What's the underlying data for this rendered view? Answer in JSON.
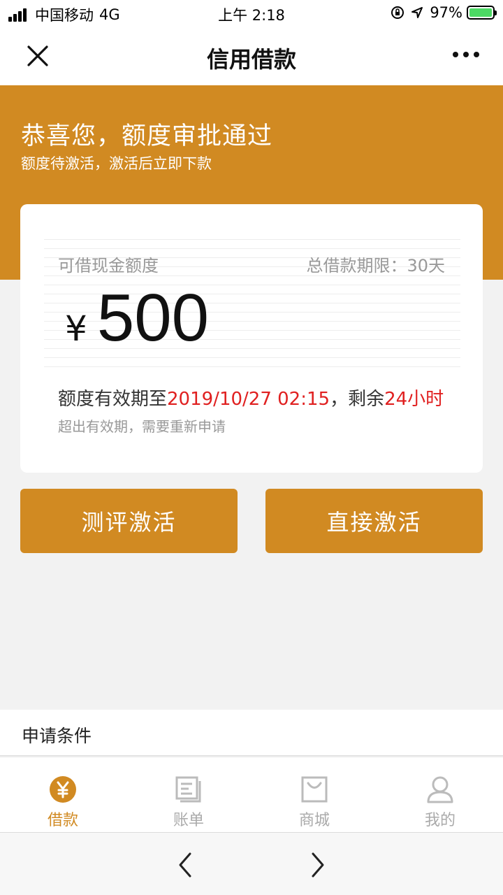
{
  "status_bar": {
    "carrier": "中国移动",
    "network": "4G",
    "time": "上午 2:18",
    "battery": "97%"
  },
  "nav": {
    "title": "信用借款"
  },
  "hero": {
    "title": "恭喜您，额度审批通过",
    "subtitle": "额度待激活，激活后立即下款"
  },
  "card": {
    "label_left": "可借现金额度",
    "label_right": "总借款期限：30天",
    "currency": "¥",
    "amount": "500",
    "validity_prefix": "额度有效期至",
    "validity_date": "2019/10/27 02:15",
    "validity_mid": "，剩余",
    "validity_remaining": "24小时",
    "note": "超出有效期，需要重新申请"
  },
  "buttons": {
    "eval_activate": "测评激活",
    "direct_activate": "直接激活"
  },
  "conditions": {
    "title": "申请条件"
  },
  "tabbar": {
    "items": [
      {
        "label": "借款",
        "icon": "yuan-icon",
        "active": true
      },
      {
        "label": "账单",
        "icon": "bill-icon",
        "active": false
      },
      {
        "label": "商城",
        "icon": "shop-icon",
        "active": false
      },
      {
        "label": "我的",
        "icon": "user-icon",
        "active": false
      }
    ]
  },
  "colors": {
    "accent": "#d18a22",
    "highlight_red": "#e02020"
  }
}
